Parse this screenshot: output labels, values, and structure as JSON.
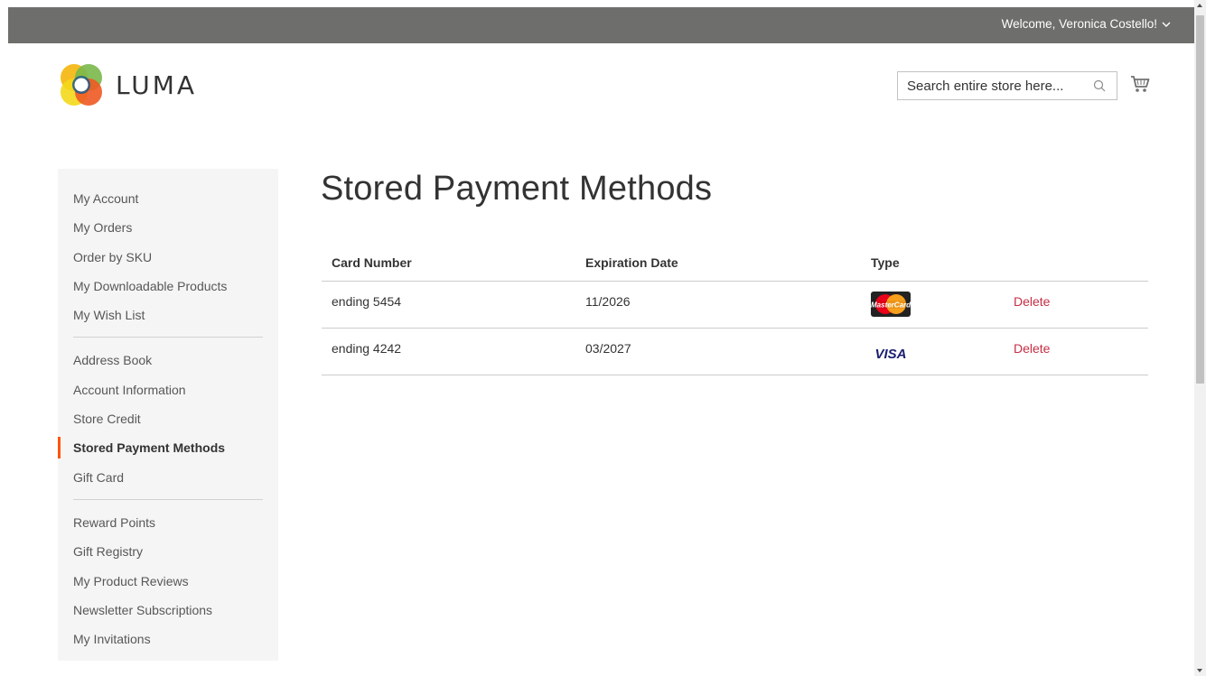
{
  "header": {
    "welcome_text": "Welcome, Veronica Costello!",
    "logo_text": "LUMA",
    "search_placeholder": "Search entire store here...",
    "bar_color": "#6e6e6c"
  },
  "sidebar": {
    "groups": [
      [
        "My Account",
        "My Orders",
        "Order by SKU",
        "My Downloadable Products",
        "My Wish List"
      ],
      [
        "Address Book",
        "Account Information",
        "Store Credit",
        "Stored Payment Methods",
        "Gift Card"
      ],
      [
        "Reward Points",
        "Gift Registry",
        "My Product Reviews",
        "Newsletter Subscriptions",
        "My Invitations"
      ]
    ],
    "active": "Stored Payment Methods",
    "active_color": "#ff5501"
  },
  "main": {
    "title": "Stored Payment Methods",
    "columns": [
      "Card Number",
      "Expiration Date",
      "Type",
      ""
    ],
    "rows": [
      {
        "card": "ending 5454",
        "expiry": "11/2026",
        "type": "mastercard-icon",
        "action": "Delete"
      },
      {
        "card": "ending 4242",
        "expiry": "03/2027",
        "type": "visa-icon",
        "action": "Delete"
      }
    ],
    "card_brand_labels": {
      "mastercard": "MasterCard",
      "visa": "VISA"
    },
    "delete_color": "#c62e44"
  }
}
